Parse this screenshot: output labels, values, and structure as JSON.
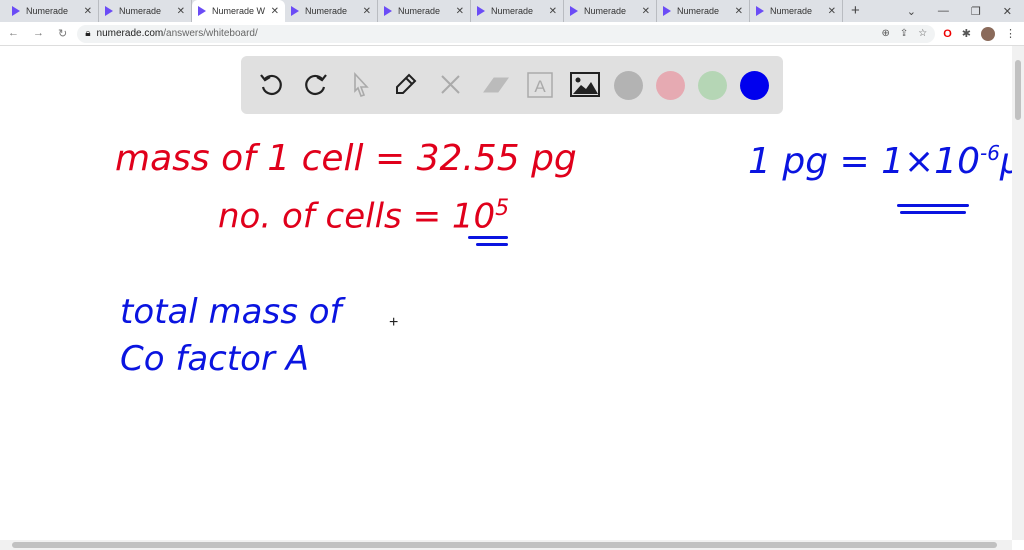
{
  "browser": {
    "tabs": [
      {
        "label": "Numerade",
        "active": false
      },
      {
        "label": "Numerade",
        "active": false
      },
      {
        "label": "Numerade W",
        "active": true
      },
      {
        "label": "Numerade",
        "active": false
      },
      {
        "label": "Numerade",
        "active": false
      },
      {
        "label": "Numerade",
        "active": false
      },
      {
        "label": "Numerade",
        "active": false
      },
      {
        "label": "Numerade",
        "active": false
      },
      {
        "label": "Numerade",
        "active": false
      }
    ],
    "url_host": "numerade.com",
    "url_path": "/answers/whiteboard/"
  },
  "toolbar": {
    "colors": [
      "#b3b3b3",
      "#e6aab2",
      "#b5d6b5",
      "#0000ee"
    ],
    "tools": [
      "undo-icon",
      "redo-icon",
      "select-icon",
      "pen-icon",
      "tools-icon",
      "eraser-icon",
      "text-icon",
      "image-icon"
    ]
  },
  "board": {
    "line1": "mass of  1 cell = 32.55 pg",
    "line2": "no. of cells = 10",
    "line2_exp": "5",
    "note": "1 pg = 1×10",
    "note_exp": "-6",
    "note_unit": "μg",
    "line3": "total mass of",
    "line4": "Co factor A"
  }
}
